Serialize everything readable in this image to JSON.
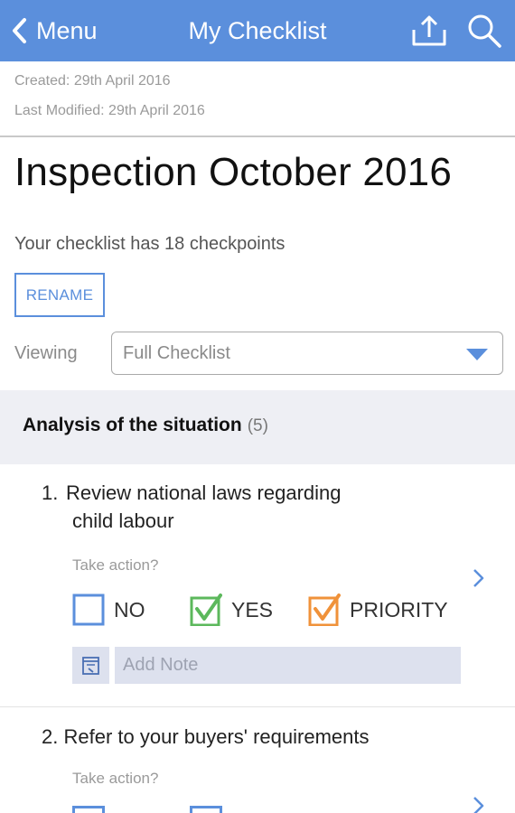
{
  "header": {
    "back_label": "Menu",
    "title": "My Checklist",
    "icons": [
      "chevron-left-icon",
      "share-upload-icon",
      "search-icon"
    ],
    "accent_color": "#5b8fdc"
  },
  "meta": {
    "created": "Created: 29th April 2016",
    "last_modified": "Last Modified: 29th April 2016"
  },
  "checklist": {
    "title": "Inspection October 2016",
    "summary": "Your checklist has 18 checkpoints",
    "rename_label": "RENAME"
  },
  "viewing": {
    "label": "Viewing",
    "selected": "Full Checklist"
  },
  "section": {
    "name": "Analysis of the situation",
    "count": "(5)"
  },
  "items": [
    {
      "number": "1.",
      "title_line1": "Review national laws regarding",
      "title_line2": "child labour",
      "take_action": "Take action?",
      "options": [
        {
          "label": "NO",
          "checked": false,
          "color": "#5b8fdc"
        },
        {
          "label": "YES",
          "checked": true,
          "color": "#5cb85c"
        },
        {
          "label": "PRIORITY",
          "checked": true,
          "color": "#f0923a"
        }
      ],
      "note_placeholder": "Add Note"
    },
    {
      "number": "2.",
      "title": "Refer to your buyers' requirements",
      "take_action": "Take action?"
    }
  ]
}
